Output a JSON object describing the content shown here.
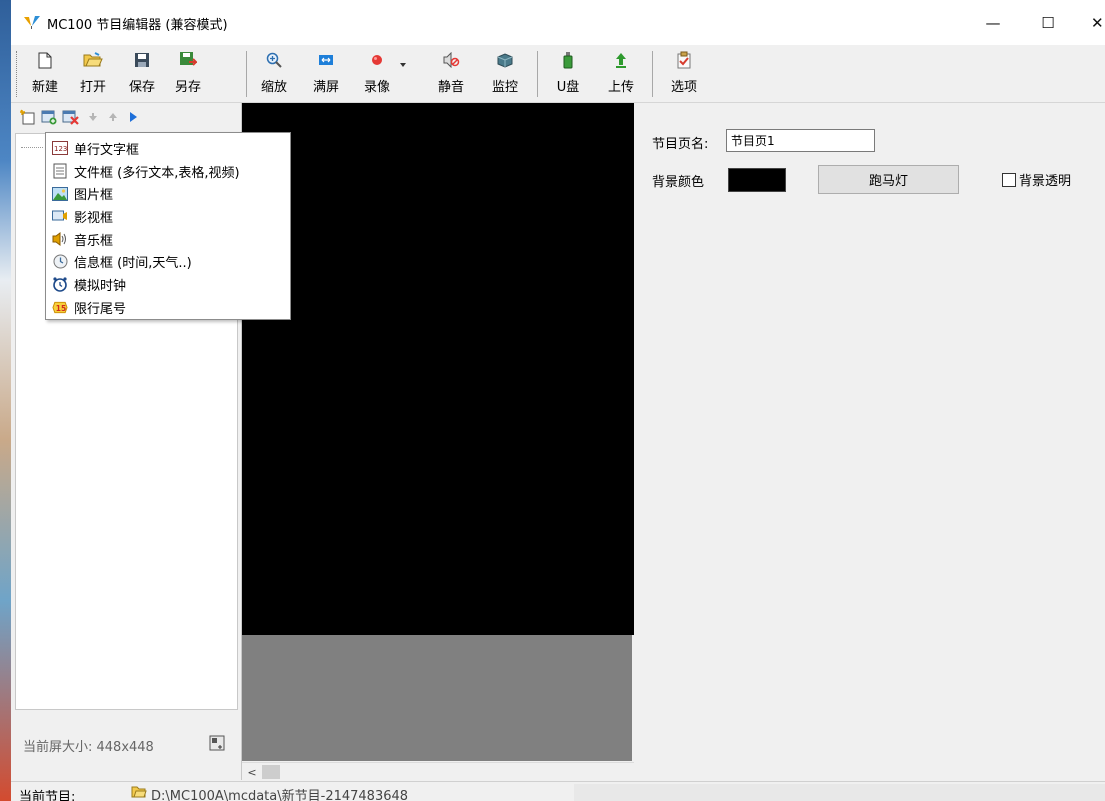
{
  "window": {
    "title": "MC100 节目编辑器 (兼容模式)",
    "controls": {
      "minimize": "—",
      "maximize": "☐",
      "close": "✕"
    }
  },
  "toolbar": {
    "items": [
      {
        "label": "新建",
        "icon": "new-file-icon"
      },
      {
        "label": "打开",
        "icon": "open-folder-icon"
      },
      {
        "label": "保存",
        "icon": "save-icon"
      },
      {
        "label": "另存",
        "icon": "save-as-icon"
      },
      {
        "label": "缩放",
        "icon": "zoom-icon"
      },
      {
        "label": "满屏",
        "icon": "fullscreen-icon"
      },
      {
        "label": "录像",
        "icon": "record-icon"
      },
      {
        "label": "静音",
        "icon": "mute-icon"
      },
      {
        "label": "监控",
        "icon": "monitor-icon"
      },
      {
        "label": "U盘",
        "icon": "usb-drive-icon"
      },
      {
        "label": "上传",
        "icon": "upload-icon"
      },
      {
        "label": "选项",
        "icon": "options-icon"
      }
    ]
  },
  "left_panel": {
    "screen_size": "当前屏大小: 448x448"
  },
  "insert_menu": {
    "items": [
      {
        "label": "单行文字框",
        "icon": "single-line-text-icon"
      },
      {
        "label": "文件框 (多行文本,表格,视频)",
        "icon": "document-icon"
      },
      {
        "label": "图片框",
        "icon": "picture-icon"
      },
      {
        "label": "影视框",
        "icon": "video-icon"
      },
      {
        "label": "音乐框",
        "icon": "speaker-icon"
      },
      {
        "label": "信息框 (时间,天气..)",
        "icon": "info-clock-icon"
      },
      {
        "label": "模拟时钟",
        "icon": "alarm-clock-icon"
      },
      {
        "label": "限行尾号",
        "icon": "restriction-badge-icon"
      }
    ]
  },
  "properties": {
    "page_name_label": "节目页名:",
    "page_name_value": "节目页1",
    "bg_color_label": "背景颜色",
    "bg_color": "#000000",
    "marquee_label": "跑马灯",
    "bg_transparent_label": "背景透明"
  },
  "status": {
    "label": "当前节目:",
    "path": "D:\\MC100A\\mcdata\\新节目-2147483648"
  },
  "colors": {
    "accent_blue": "#1e6fd9",
    "canvas_black": "#000000",
    "canvas_gray": "#808080"
  }
}
